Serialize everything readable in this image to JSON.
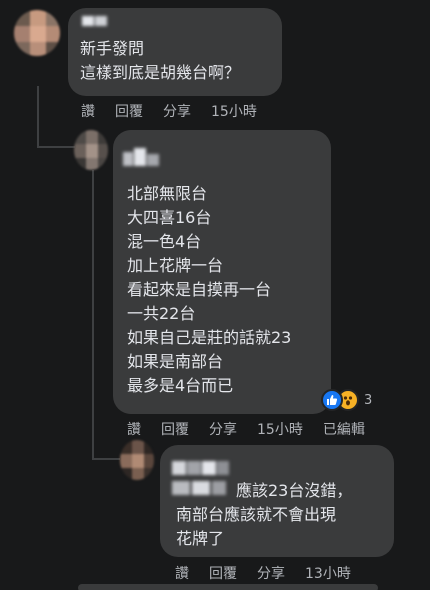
{
  "comments": [
    {
      "body": "新手發問\n這樣到底是胡幾台啊？",
      "actions": {
        "reply_short": "讚",
        "reply": "回覆",
        "share": "分享",
        "time": "15小時"
      }
    },
    {
      "body": "北部無限台\n大四喜16台\n混一色4台\n加上花牌一台\n看起來是自摸再一台\n一共22台\n如果自己是莊的話就23\n如果是南部台\n最多是4台而已",
      "reactions": {
        "icons": [
          "like-icon",
          "wow-icon"
        ],
        "count": "3"
      },
      "actions": {
        "reply_short": "讚",
        "reply": "回覆",
        "share": "分享",
        "time": "15小時",
        "edited": "已編輯"
      }
    },
    {
      "body": "應該23台沒錯，\n南部台應該就不會出現\n花牌了",
      "actions": {
        "reply_short": "讚",
        "reply": "回覆",
        "share": "分享",
        "time": "13小時"
      }
    }
  ],
  "colors": {
    "background": "#18191a",
    "bubble": "#3a3b3c",
    "text": "#e4e6eb",
    "meta": "#b0b3b8",
    "like": "#1877f2",
    "wow": "#f7b125"
  }
}
